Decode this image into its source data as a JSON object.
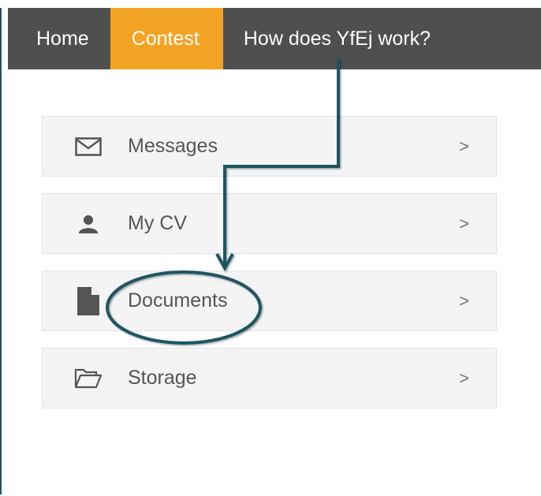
{
  "nav": {
    "items": [
      {
        "label": "Home",
        "active": false
      },
      {
        "label": "Contest",
        "active": true
      },
      {
        "label": "How does YfEj work?",
        "active": false
      }
    ]
  },
  "menu": {
    "items": [
      {
        "label": "Messages",
        "icon": "envelope-icon",
        "chevron": ">"
      },
      {
        "label": "My CV",
        "icon": "user-icon",
        "chevron": ">"
      },
      {
        "label": "Documents",
        "icon": "document-icon",
        "chevron": ">"
      },
      {
        "label": "Storage",
        "icon": "folder-open-icon",
        "chevron": ">"
      }
    ]
  },
  "colors": {
    "navbar_bg": "#4f4f4f",
    "active_tab": "#f3a323",
    "annotation": "#1f5463",
    "menu_bg": "#f4f4f4"
  }
}
